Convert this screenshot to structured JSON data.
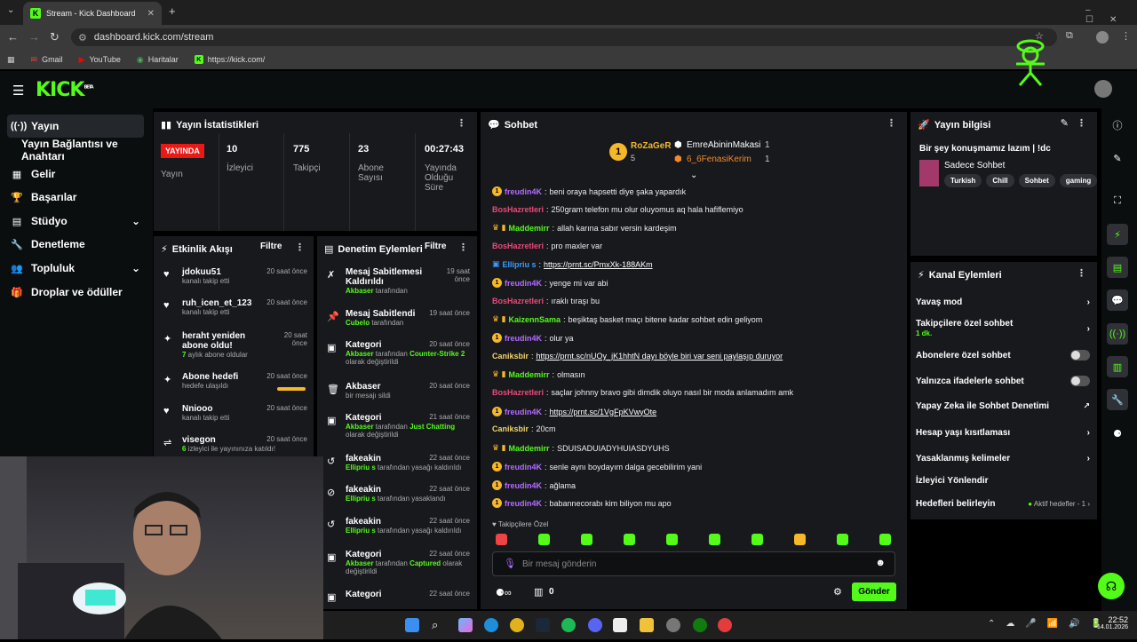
{
  "browser": {
    "tab_title": "Stream - Kick Dashboard",
    "url": "dashboard.kick.com/stream",
    "bookmarks": [
      "Gmail",
      "YouTube",
      "Haritalar",
      "https://kick.com/"
    ]
  },
  "brand": {
    "logo": "KICK",
    "beta": "BETA",
    "accent": "#53fc18"
  },
  "sidebar": {
    "items": [
      {
        "label": "Yayın",
        "icon": "broadcast-icon"
      },
      {
        "label": "Yayın Bağlantısı ve Anahtarı"
      },
      {
        "label": "Gelir",
        "icon": "revenue-icon"
      },
      {
        "label": "Başarılar",
        "icon": "trophy-icon"
      },
      {
        "label": "Stüdyo",
        "icon": "studio-icon"
      },
      {
        "label": "Denetleme",
        "icon": "wrench-icon"
      },
      {
        "label": "Topluluk",
        "icon": "community-icon"
      },
      {
        "label": "Droplar ve ödüller",
        "icon": "gift-icon"
      }
    ]
  },
  "stats": {
    "title": "Yayın İstatistikleri",
    "live": "YAYINDA",
    "live_sub": "Yayın",
    "items": [
      {
        "value": "10",
        "label": "İzleyici"
      },
      {
        "value": "775",
        "label": "Takipçi"
      },
      {
        "value": "23",
        "label": "Abone Sayısı"
      },
      {
        "value": "00:27:43",
        "label": "Yayında Olduğu Süre"
      }
    ]
  },
  "activity": {
    "title": "Etkinlik Akışı",
    "filter": "Filtre",
    "items": [
      {
        "title": "jdokuu51",
        "sub": "kanalı takip etti",
        "time": "20 saat önce"
      },
      {
        "title": "ruh_icen_et_123",
        "sub": "kanalı takip etti",
        "time": "20 saat önce"
      },
      {
        "title": "heraht yeniden abone oldu!",
        "sub": "7 aylık abone oldular",
        "time": "20 saat önce"
      },
      {
        "title": "Abone hedefi",
        "sub": "hedefe ulaşıldı",
        "time": "20 saat önce",
        "progress": 0.95
      },
      {
        "title": "Nniooo",
        "sub": "kanalı takip etti",
        "time": "20 saat önce"
      },
      {
        "title": "visegon",
        "sub": "6 izleyici ile yayınınıza katıldı!",
        "time": "20 saat önce"
      }
    ]
  },
  "modlog": {
    "title": "Denetim Eylemleri",
    "filter": "Filtre",
    "items": [
      {
        "title": "Mesaj Sabitlemesi Kaldırıldı",
        "user": "Akbaser",
        "rest": " tarafından",
        "time": "19 saat önce"
      },
      {
        "title": "Mesaj Sabitlendi",
        "user": "Cubelo",
        "rest": " tarafından",
        "time": "19 saat önce"
      },
      {
        "title": "Kategori",
        "user": "Akbaser",
        "rest": " tarafından Counter-Strike 2 olarak değiştirildi",
        "time": "20 saat önce"
      },
      {
        "title": "Akbaser",
        "user": "",
        "rest": "bir mesajı sildi",
        "time": "20 saat önce"
      },
      {
        "title": "Kategori",
        "user": "Akbaser",
        "rest": " tarafından Just Chatting olarak değiştirildi",
        "time": "21 saat önce"
      },
      {
        "title": "fakeakin",
        "user": "Ellipriu s",
        "rest": " tarafından yasağı kaldırıldı",
        "time": "22 saat önce"
      },
      {
        "title": "fakeakin",
        "user": "Ellipriu s",
        "rest": " tarafından yasaklandı",
        "time": "22 saat önce"
      },
      {
        "title": "fakeakin",
        "user": "Ellipriu s",
        "rest": " tarafından yasağı kaldırıldı",
        "time": "22 saat önce"
      },
      {
        "title": "Kategori",
        "user": "Akbaser",
        "rest": " tarafından Captured olarak değiştirildi",
        "time": "22 saat önce"
      },
      {
        "title": "Kategori",
        "user": "",
        "rest": "",
        "time": "22 saat önce"
      }
    ]
  },
  "chat": {
    "title": "Sohbet",
    "top": [
      {
        "name": "RoZaGeR",
        "count": "5"
      },
      {
        "name": "EmreAbininMakasi",
        "count": "1"
      },
      {
        "name": "6_6FenasiKerim",
        "count": "1"
      }
    ],
    "messages": [
      {
        "user": "freudin4K",
        "color": "#b36bff",
        "text": "beni oraya hapsetti diye şaka yapardık"
      },
      {
        "user": "BosHazretleri",
        "color": "#e94a7a",
        "text": "250gram telefon mu olur oluyomus aq hala hafiflemiyo"
      },
      {
        "user": "Maddemirr",
        "color": "#53fc18",
        "text": "allah karına sabır versin kardeşim"
      },
      {
        "user": "BosHazretleri",
        "color": "#e94a7a",
        "text": "pro maxler var"
      },
      {
        "user": "Ellipriu s",
        "color": "#3d9bff",
        "text": "https://prnt.sc/PmxXk-188AKm"
      },
      {
        "user": "freudin4K",
        "color": "#b36bff",
        "text": "yenge mi var abi"
      },
      {
        "user": "BosHazretleri",
        "color": "#e94a7a",
        "text": "ıraklı tıraşı bu"
      },
      {
        "user": "KaizennSama",
        "color": "#53fc18",
        "text": "beşiktaş basket maçı bitene kadar sohbet edin geliyom"
      },
      {
        "user": "freudin4K",
        "color": "#b36bff",
        "text": "olur ya"
      },
      {
        "user": "Caniksbir",
        "color": "#f0d36b",
        "text": "https://prnt.sc/nUOy_jK1hhtN dayı böyle biri var seni paylaşıp duruyor"
      },
      {
        "user": "Maddemirr",
        "color": "#53fc18",
        "text": "olmasın"
      },
      {
        "user": "BosHazretleri",
        "color": "#e94a7a",
        "text": "saçlar johnny bravo gibi dimdik oluyo nasıl bir moda anlamadım amk"
      },
      {
        "user": "freudin4K",
        "color": "#b36bff",
        "text": "https://prnt.sc/1VgFpKVwyOte"
      },
      {
        "user": "Caniksbir",
        "color": "#f0d36b",
        "text": "20cm"
      },
      {
        "user": "Maddemirr",
        "color": "#53fc18",
        "text": "SDUISADUIADYHUIASDYUHS"
      },
      {
        "user": "freudin4K",
        "color": "#b36bff",
        "text": "senle aynı boydayım dalga gecebilirim yani"
      },
      {
        "user": "freudin4K",
        "color": "#b36bff",
        "text": "ağlama"
      },
      {
        "user": "freudin4K",
        "color": "#b36bff",
        "text": "babannecorabı kim biliyon mu apo"
      }
    ],
    "mode": "Takipçilere Özel",
    "placeholder": "Bir mesaj gönderin",
    "points": "0",
    "send": "Gönder"
  },
  "stream_info": {
    "title": "Yayın bilgisi",
    "stream_title": "Bir şey konuşmamız lazım | !dc",
    "category": "Sadece Sohbet",
    "tags": [
      "Turkish",
      "Chill",
      "Sohbet",
      "gaming"
    ]
  },
  "channel_actions": {
    "title": "Kanal Eylemleri",
    "items": [
      {
        "label": "Yavaş mod",
        "type": "arrow"
      },
      {
        "label": "Takipçilere özel sohbet",
        "sub": "1 dk.",
        "type": "arrow"
      },
      {
        "label": "Abonelere özel sohbet",
        "type": "toggle"
      },
      {
        "label": "Yalnızca ifadelerle sohbet",
        "type": "toggle"
      },
      {
        "label": "Yapay Zeka ile Sohbet Denetimi",
        "type": "external"
      },
      {
        "label": "Hesap yaşı kısıtlaması",
        "type": "arrow"
      },
      {
        "label": "Yasaklanmış kelimeler",
        "type": "arrow"
      },
      {
        "label": "İzleyici Yönlendir",
        "type": "none"
      },
      {
        "label": "Hedefleri belirleyin",
        "status": "Aktif hedefler - 1",
        "type": "arrow"
      }
    ]
  },
  "taskbar": {
    "time": "22:52",
    "date": "14.01.2026"
  }
}
